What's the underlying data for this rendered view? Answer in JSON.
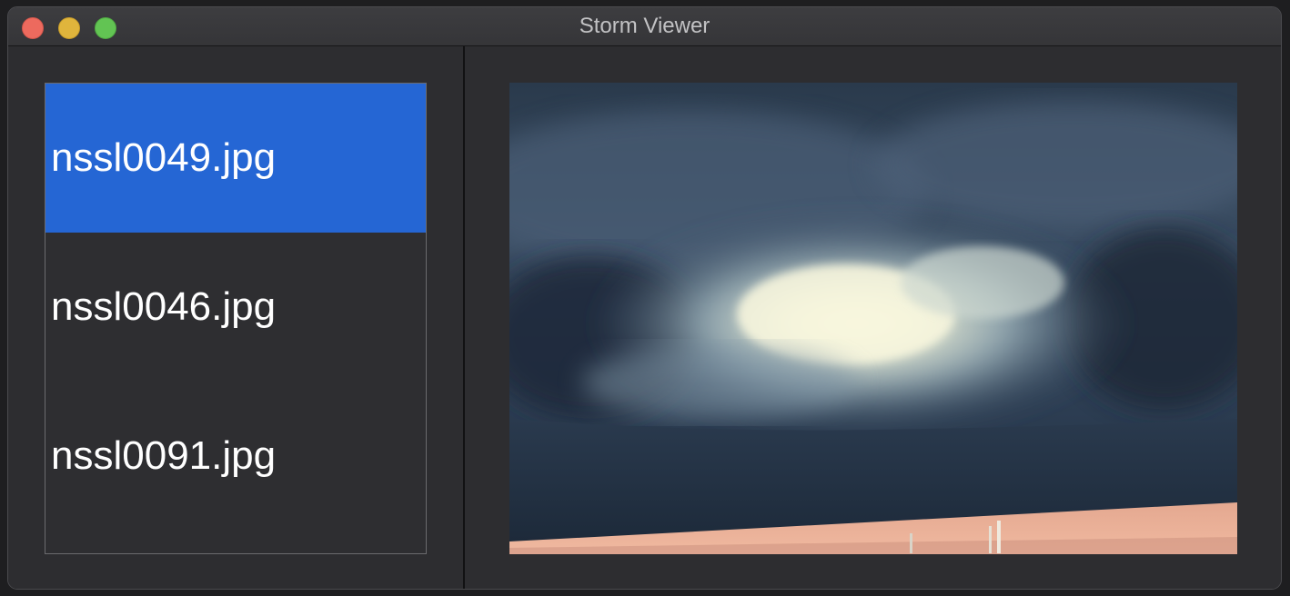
{
  "window": {
    "title": "Storm Viewer"
  },
  "sidebar": {
    "items": [
      {
        "label": "nssl0049.jpg",
        "selected": true
      },
      {
        "label": "nssl0046.jpg",
        "selected": false
      },
      {
        "label": "nssl0091.jpg",
        "selected": false
      }
    ]
  },
  "preview": {
    "image": "storm-cloud-photo"
  },
  "colors": {
    "selection": "#2566d4",
    "close": "#ed6a5e",
    "minimize": "#e0b53c",
    "maximize": "#62c453"
  }
}
